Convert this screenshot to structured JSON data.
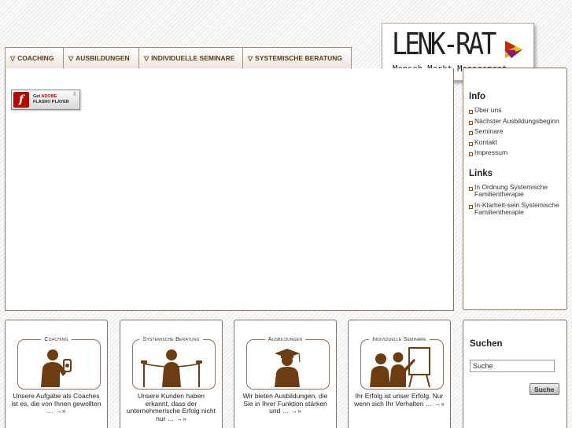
{
  "nav": {
    "items": [
      {
        "label": "Coaching"
      },
      {
        "label": "Ausbildungen"
      },
      {
        "label": "Individuelle Seminare"
      },
      {
        "label": "Systemische Beratung"
      }
    ]
  },
  "logo": {
    "title": "LENK-RAT",
    "subtitle": "Mensch Markt Management"
  },
  "flash": {
    "line1_a": "Get ",
    "line1_b": "ADOBE",
    "line2": "FLASH® PLAYER"
  },
  "sidebar": {
    "info_heading": "Info",
    "info_items": [
      {
        "label": "Über uns"
      },
      {
        "label": "Nächster Ausbildungsbeginn"
      },
      {
        "label": "Seminare"
      },
      {
        "label": "Kontakt"
      },
      {
        "label": "Impressum"
      }
    ],
    "links_heading": "Links",
    "links_items": [
      {
        "label": "In Ordnung Systemische Familientherapie"
      },
      {
        "label": "In-Klarheit-sein Systemische Familientherapie"
      }
    ]
  },
  "boxes": [
    {
      "title": "Coaching",
      "text": "Unsere Aufgabe als Coaches ist es, die von Ihnen gewollten …",
      "more": "→»",
      "icon": "coaching-person-icon"
    },
    {
      "title": "Systemische Beratung",
      "text": "Unsere Kunden haben erkannt, dass der unternehmerische Erfolg nicht nur …",
      "more": "→»",
      "icon": "finish-line-person-icon"
    },
    {
      "title": "Ausbildungen",
      "text": "Wir bieten Ausbildungen, die Sie in Ihrer Funktion stärken und …",
      "more": "→»",
      "icon": "graduate-icon"
    },
    {
      "title": "Individuelle Seminare",
      "text": "Ihr Erfolg ist unser Erfolg. Nur wenn sich Ihr Verhalten …",
      "more": "→»",
      "icon": "presentation-icon"
    }
  ],
  "search": {
    "heading": "Suchen",
    "value": "Suche",
    "button": "Suche"
  },
  "colors": {
    "accent": "#a04800",
    "brown": "#5a3a1a",
    "border": "#8a7260"
  }
}
